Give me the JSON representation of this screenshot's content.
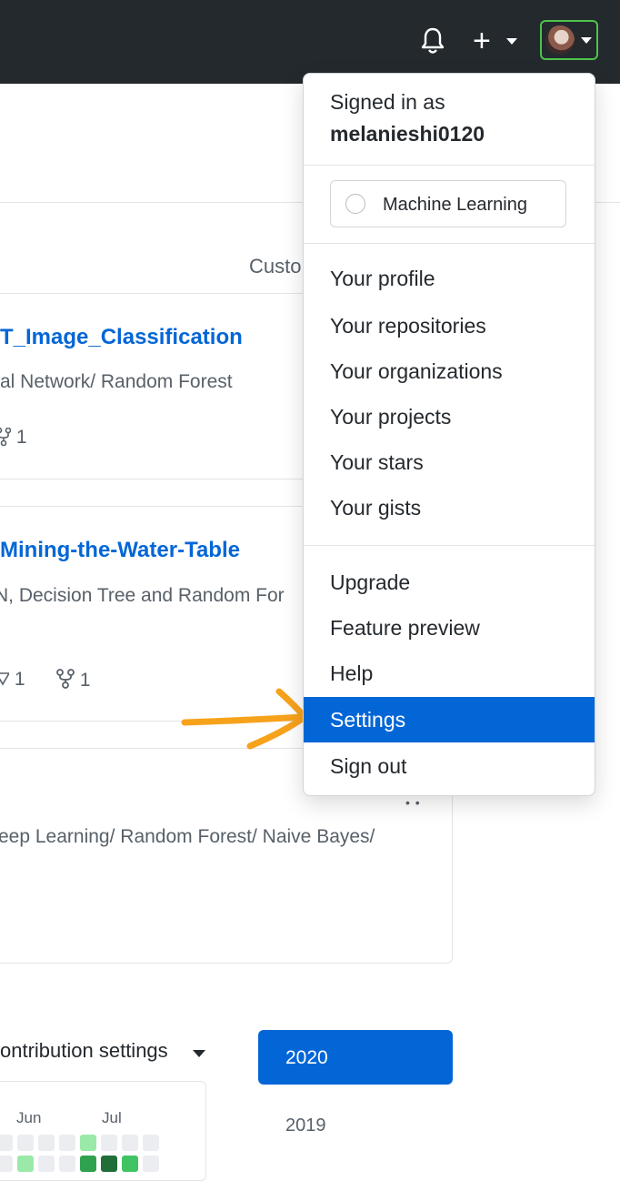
{
  "header": {
    "bell_icon": "bell-icon",
    "plus_label": "+",
    "avatar_icon": "avatar-icon"
  },
  "page": {
    "customize_label": "Custo",
    "repos": [
      {
        "name": "T_Image_Classification",
        "description": "al Network/ Random Forest",
        "forks": "1"
      },
      {
        "name": "Mining-the-Water-Table",
        "description": "N, Decision Tree and Random For",
        "stars": "1",
        "forks": "1"
      },
      {
        "description": "eep Learning/ Random Forest/ Naive Bayes/"
      }
    ],
    "contribution_settings": "ontribution settings",
    "months": [
      "Jun",
      "Jul"
    ],
    "years": [
      "2020",
      "2019"
    ]
  },
  "dropdown": {
    "signed_in_as": "Signed in as",
    "username": "melanieshi0120",
    "status": "Machine Learning",
    "group1": [
      "Your profile",
      "Your repositories",
      "Your organizations",
      "Your projects",
      "Your stars",
      "Your gists"
    ],
    "group2": [
      "Upgrade",
      "Feature preview",
      "Help",
      "Settings",
      "Sign out"
    ]
  },
  "colors": {
    "header_bg": "#24292e",
    "link": "#0366d6",
    "active_bg": "#0366d6",
    "arrow": "#f7a21b",
    "avatar_ring": "#4cc44a"
  }
}
